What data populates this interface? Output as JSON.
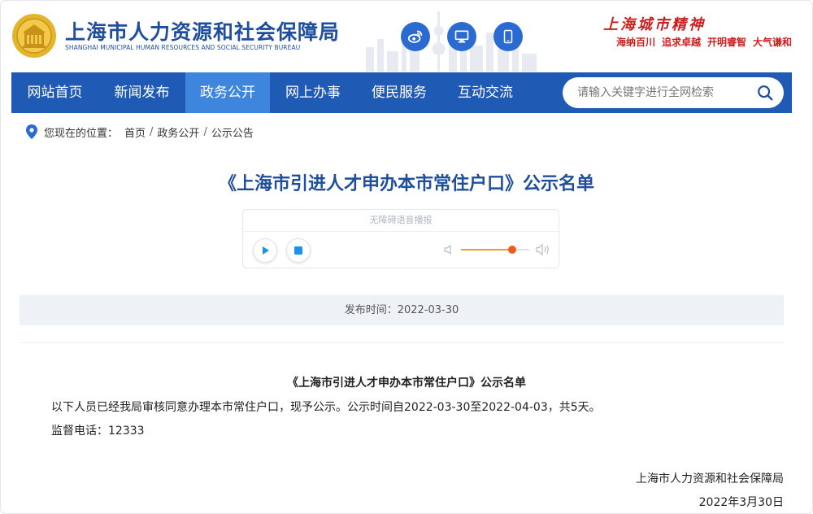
{
  "header": {
    "bureau_name_cn": "上海市人力资源和社会保障局",
    "bureau_name_en": "SHANGHAI MUNICIPAL HUMAN RESOURCES AND SOCIAL SECURITY BUREAU",
    "logo_icon": "bureau-emblem-icon",
    "buttons": [
      {
        "name": "weibo-icon"
      },
      {
        "name": "desktop-icon"
      },
      {
        "name": "mobile-icon"
      }
    ],
    "city_spirit": {
      "title": "上海城市精神",
      "items": [
        "海纳百川",
        "追求卓越",
        "开明睿智",
        "大气谦和"
      ]
    }
  },
  "nav": {
    "items": [
      {
        "label": "网站首页",
        "active": false
      },
      {
        "label": "新闻发布",
        "active": false
      },
      {
        "label": "政务公开",
        "active": true
      },
      {
        "label": "网上办事",
        "active": false
      },
      {
        "label": "便民服务",
        "active": false
      },
      {
        "label": "互动交流",
        "active": false
      }
    ],
    "search": {
      "placeholder": "请输入关键字进行全网检索",
      "value": ""
    }
  },
  "breadcrumb": {
    "prefix": "您现在的位置：",
    "items": [
      "首页",
      "政务公开",
      "公示公告"
    ],
    "separator": "/"
  },
  "article": {
    "title": "《上海市引进人才申办本市常住户口》公示名单",
    "player": {
      "label": "无障碍语音播报",
      "volume": 0.75
    },
    "publish_time": "发布时间：2022-03-30",
    "heading": "《上海市引进人才申办本市常住户口》公示名单",
    "body_line": "以下人员已经我局审核同意办理本市常住户口，现予公示。公示时间自2022-03-30至2022-04-03，共5天。",
    "phone_line": "监督电话：12333",
    "signature": "上海市人力资源和社会保障局",
    "date": "2022年3月30日"
  },
  "colors": {
    "brand_blue": "#1f4e9c",
    "nav_blue": "#1f5bb5",
    "nav_active": "#3e86dd",
    "spirit_red": "#cc1f1f",
    "volume_orange": "#f05a1a"
  }
}
